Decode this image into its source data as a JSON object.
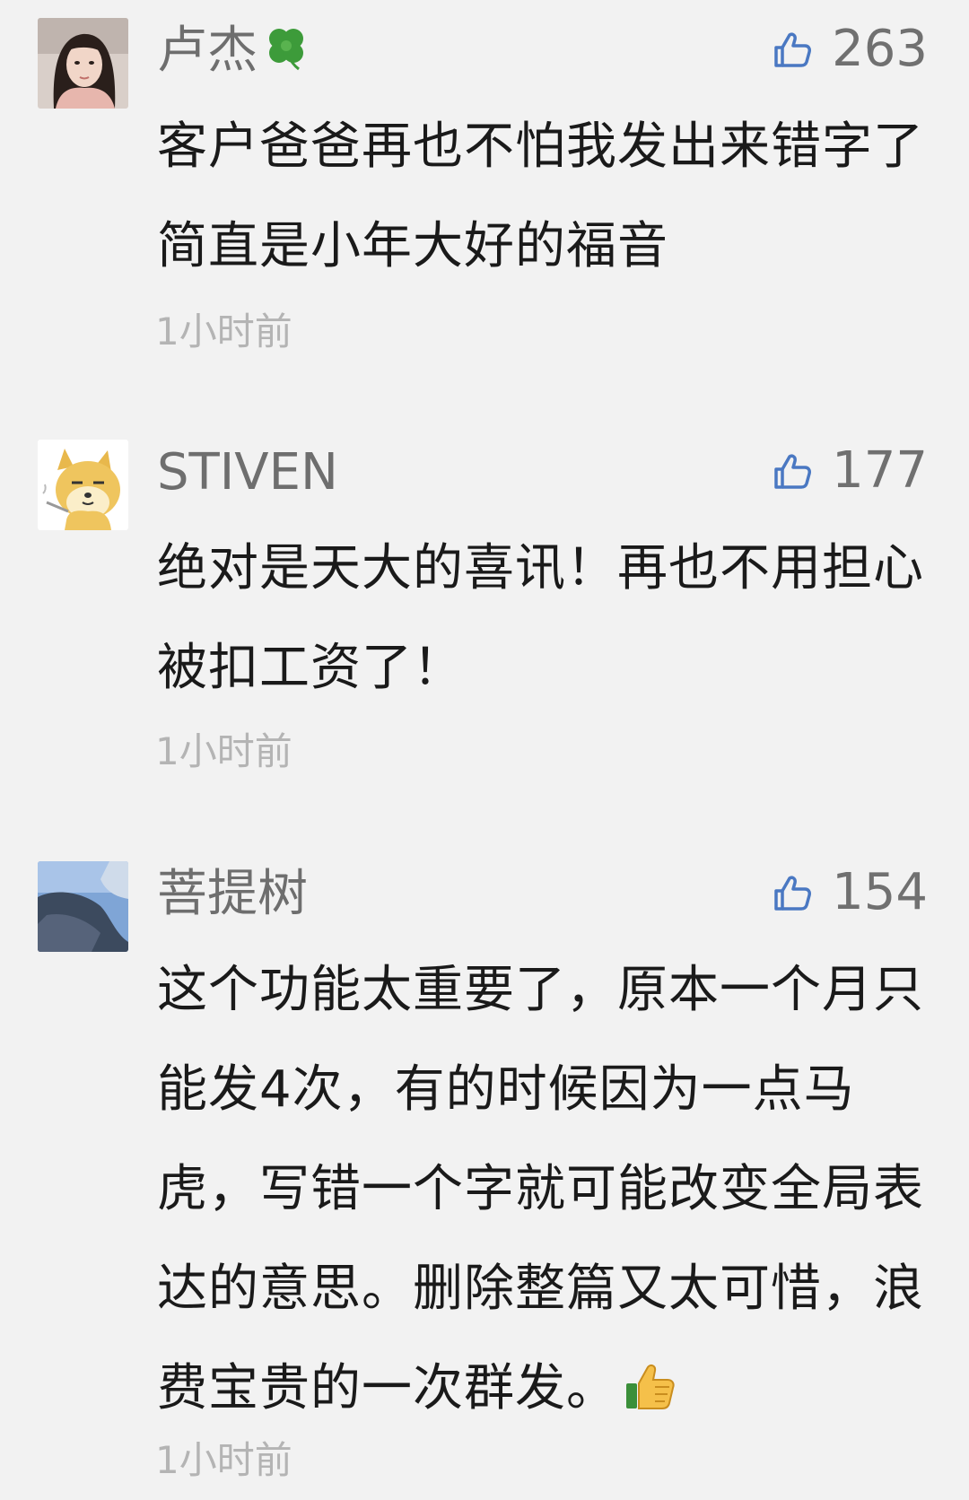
{
  "comments": [
    {
      "name": "卢杰",
      "name_emoji": "clover",
      "likes": "263",
      "content": "客户爸爸再也不怕我发出来错字了 简直是小年大好的福音",
      "time": "1小时前",
      "avatar": "woman-photo-avatar"
    },
    {
      "name": "STIVEN",
      "likes": "177",
      "content": "绝对是天大的喜讯！再也不用担心被扣工资了！",
      "time": "1小时前",
      "avatar": "shiba-dog-cartoon-avatar"
    },
    {
      "name": "菩提树",
      "likes": "154",
      "content": "这个功能太重要了，原本一个月只能发4次，有的时候因为一点马虎，写错一个字就可能改变全局表达的意思。删除整篇又太可惜，浪费宝贵的一次群发。",
      "content_emoji": "thumbs-up",
      "time": "1小时前",
      "avatar": "blue-sky-photo-avatar"
    }
  ],
  "colors": {
    "background": "#f2f2f2",
    "name": "#6e6e6e",
    "content": "#1a1a1a",
    "time": "#b4b4b4",
    "like_icon": "#4a78c2"
  }
}
